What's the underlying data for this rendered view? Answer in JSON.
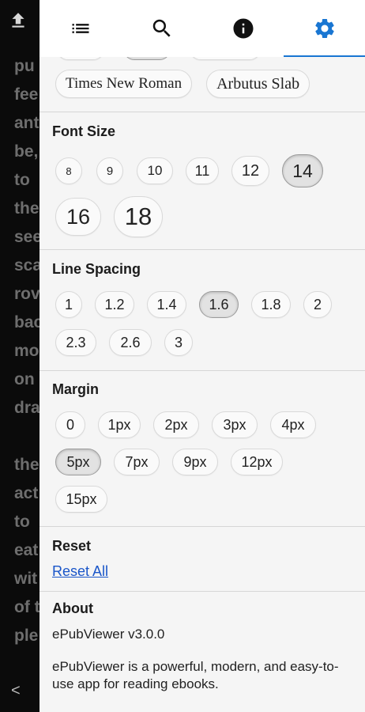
{
  "reader": {
    "lines": [
      "pu",
      "fee",
      "ant",
      "be,",
      "to",
      "the",
      "see",
      "sca",
      "rov",
      "bac",
      "mo",
      "on",
      "dra",
      "",
      "the",
      "act",
      "to",
      "eat",
      "wit",
      "of t",
      "ple"
    ],
    "back_glyph": "<"
  },
  "tabs": [
    {
      "name": "toc",
      "icon": "list-icon"
    },
    {
      "name": "search",
      "icon": "search-icon"
    },
    {
      "name": "info",
      "icon": "info-icon"
    },
    {
      "name": "settings",
      "icon": "gear-icon",
      "active": true
    }
  ],
  "font_family": {
    "options": [
      "Times New Roman",
      "Arbutus Slab"
    ]
  },
  "font_size": {
    "title": "Font Size",
    "options": [
      "8",
      "9",
      "10",
      "11",
      "12",
      "14",
      "16",
      "18"
    ],
    "selected": "14"
  },
  "line_spacing": {
    "title": "Line Spacing",
    "options": [
      "1",
      "1.2",
      "1.4",
      "1.6",
      "1.8",
      "2",
      "2.3",
      "2.6",
      "3"
    ],
    "selected": "1.6"
  },
  "margin": {
    "title": "Margin",
    "options": [
      "0",
      "1px",
      "2px",
      "3px",
      "4px",
      "5px",
      "7px",
      "9px",
      "12px",
      "15px"
    ],
    "selected": "5px"
  },
  "reset": {
    "title": "Reset",
    "link": "Reset All"
  },
  "about": {
    "title": "About",
    "version": "ePubViewer v3.0.0",
    "description": "ePubViewer is a powerful, modern, and easy-to-use app for reading ebooks."
  },
  "colors": {
    "accent": "#1976d2",
    "link": "#1a56c9",
    "panel_bg": "#f5f5f5"
  }
}
